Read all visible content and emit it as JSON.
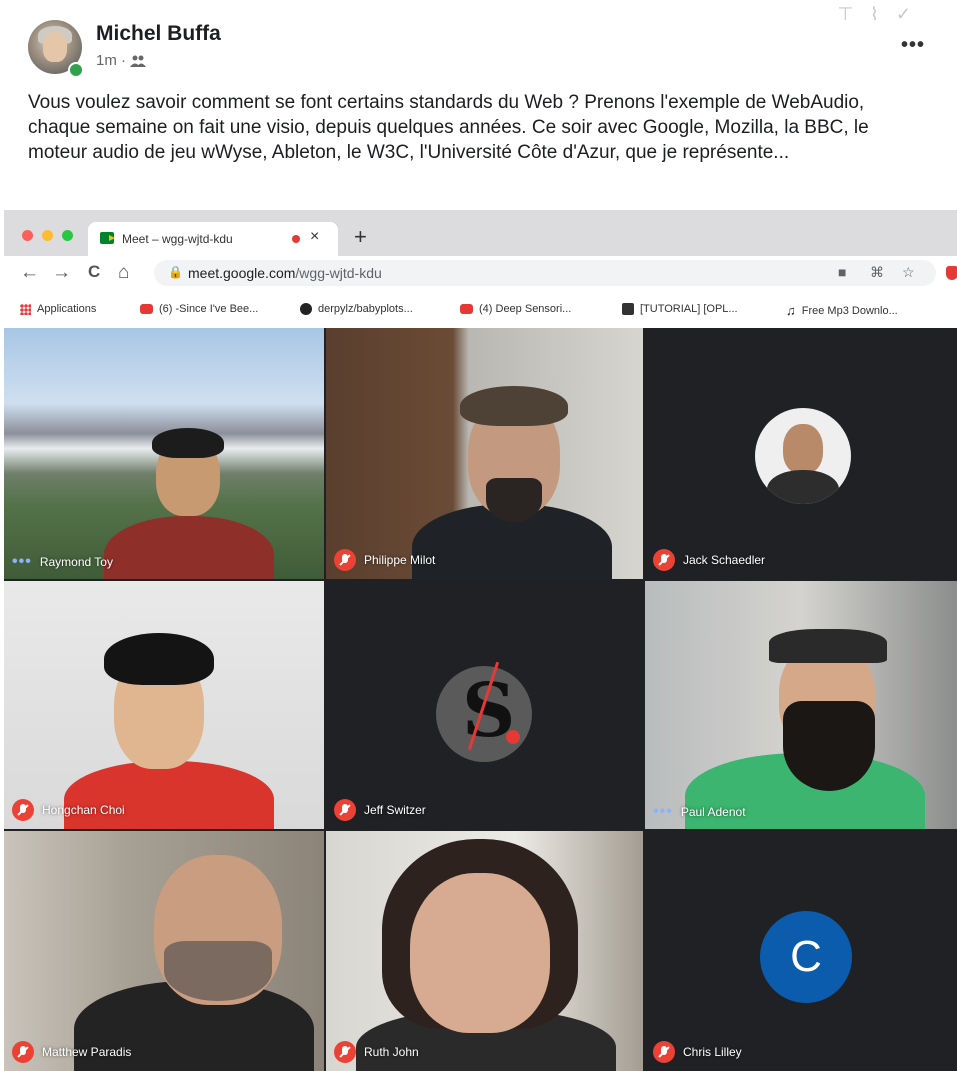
{
  "post": {
    "author": "Michel Buffa",
    "time": "1m ·",
    "audience_icon": "friends-icon",
    "more_label": "•••",
    "top_icons": "⊤ ⌇ ✓",
    "text": "Vous voulez savoir comment se font certains standards du Web ? Prenons l'exemple de WebAudio, chaque semaine on fait une visio, depuis quelques années. Ce soir avec Google, Mozilla, la BBC, le moteur audio de jeu wWyse, Ableton, le W3C, l'Université Côte d'Azur, que je représente..."
  },
  "browser": {
    "tab_title": "Meet – wgg-wjtd-kdu",
    "tab_close": "×",
    "new_tab": "+",
    "nav": {
      "back": "←",
      "forward": "→",
      "reload": "C",
      "home": "⌂"
    },
    "url_domain": "meet.google.com",
    "url_path": "/wgg-wjtd-kdu",
    "lock": "🔒",
    "omni_icons": [
      "■",
      "⌘",
      "☆"
    ],
    "bookmarks": [
      {
        "icon": "apps-grid-icon",
        "label": "Applications"
      },
      {
        "icon": "youtube-icon",
        "label": "(6) -Since I've Bee..."
      },
      {
        "icon": "github-icon",
        "label": "derpylz/babyplots..."
      },
      {
        "icon": "youtube-icon",
        "label": "(4) Deep Sensori..."
      },
      {
        "icon": "page-icon",
        "label": "[TUTORIAL] [OPL..."
      },
      {
        "icon": "music-note-icon",
        "label": "Free Mp3 Downlo..."
      }
    ],
    "music_glyph": "♫"
  },
  "meet": {
    "participants": [
      {
        "name": "Raymond Toy",
        "status": "speaking"
      },
      {
        "name": "Philippe Milot",
        "status": "muted"
      },
      {
        "name": "Jack Schaedler",
        "status": "muted"
      },
      {
        "name": "Hongchan Choi",
        "status": "muted"
      },
      {
        "name": "Jeff Switzer",
        "status": "muted"
      },
      {
        "name": "Paul Adenot",
        "status": "speaking"
      },
      {
        "name": "Matthew Paradis",
        "status": "muted"
      },
      {
        "name": "Ruth John",
        "status": "muted"
      },
      {
        "name": "Chris Lilley",
        "status": "muted"
      }
    ],
    "speaking_dots": "•••",
    "jeff_logo_letter": "S",
    "chris_initial": "C"
  },
  "colors": {
    "mic_off": "#ea4335",
    "meet_bg": "#202124",
    "avatar_c": "#0b5cad"
  }
}
